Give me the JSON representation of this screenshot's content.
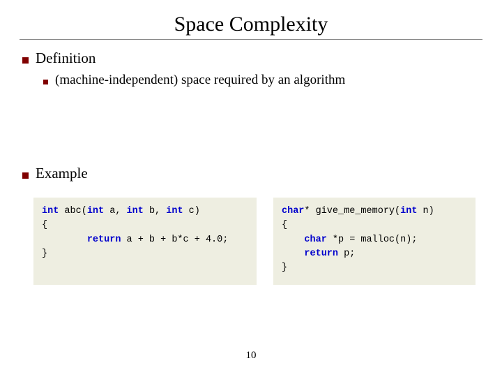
{
  "title": "Space Complexity",
  "sections": {
    "definition": {
      "heading": "Definition",
      "items": [
        "(machine-independent) space required by an algorithm"
      ]
    },
    "example": {
      "heading": "Example"
    }
  },
  "code": {
    "left": {
      "l1_kw1": "int",
      "l1_fn": " abc(",
      "l1_kw2": "int",
      "l1_a": " a, ",
      "l1_kw3": "int",
      "l1_b": " b, ",
      "l1_kw4": "int",
      "l1_c": " c)",
      "l2": "{",
      "l3_indent": "        ",
      "l3_kw": "return",
      "l3_rest": " a + b + b*c + 4.0;",
      "l4": "}"
    },
    "right": {
      "l1_kw1": "char",
      "l1_star": "* give_me_memory(",
      "l1_kw2": "int",
      "l1_n": " n)",
      "l2": "{",
      "l3_indent": "    ",
      "l3_kw1": "char",
      "l3_mid": " *p = malloc(n);",
      "l4_indent": "    ",
      "l4_kw": "return",
      "l4_rest": " p;",
      "l5": "}"
    }
  },
  "page_number": "10"
}
